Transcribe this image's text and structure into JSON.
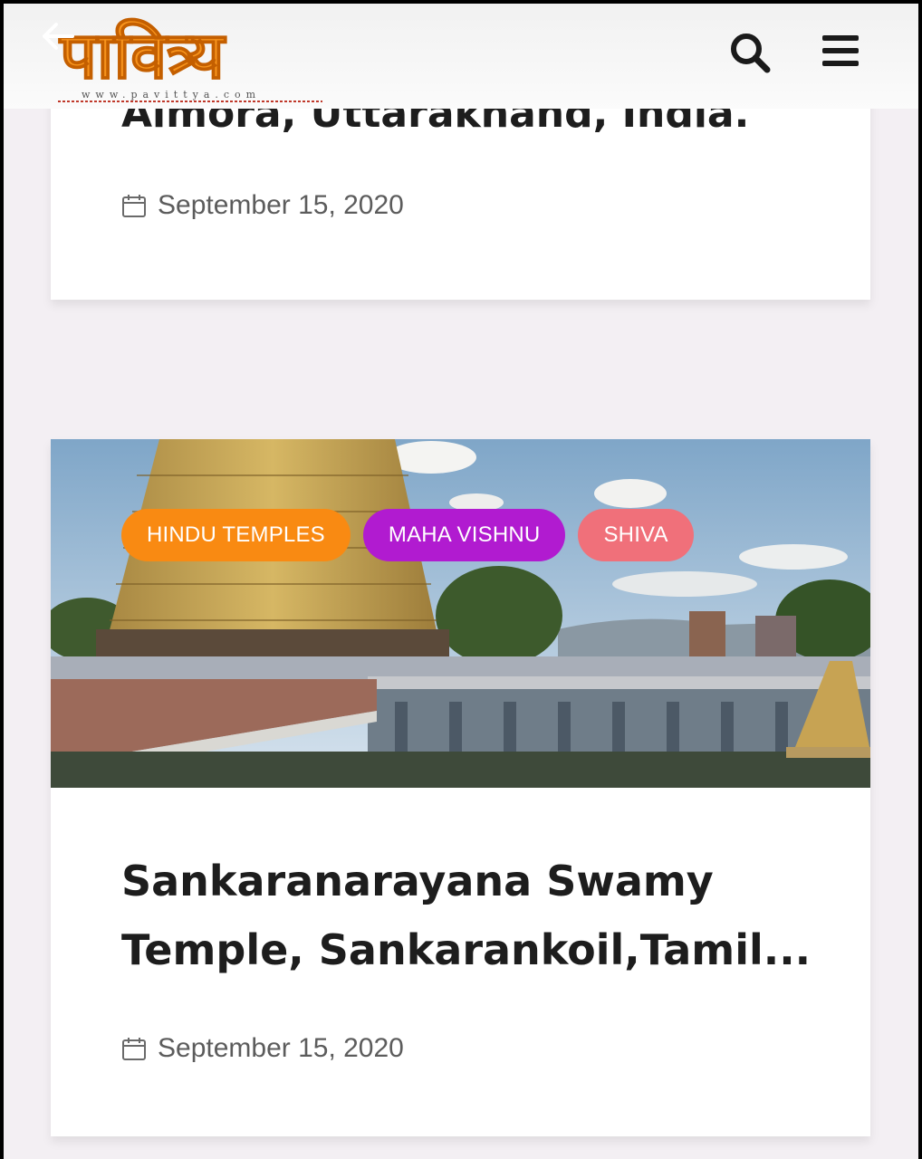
{
  "header": {
    "logo_text": "पावित्र्य",
    "logo_url": "www.pavittya.com",
    "accent": "#f7941d"
  },
  "posts": [
    {
      "title": "Almora, Uttarakhand, India.",
      "date": "September 15, 2020"
    },
    {
      "tags": [
        "HINDU TEMPLES",
        "MAHA VISHNU",
        "SHIVA"
      ],
      "title": "Sankaranarayana Swamy Temple, Sankarankoil,Tamil...",
      "date": "September 15, 2020"
    }
  ],
  "colors": {
    "tag_hindu": "#f98a12",
    "tag_vishnu": "#b11bd0",
    "tag_shiva": "#f0707a"
  }
}
